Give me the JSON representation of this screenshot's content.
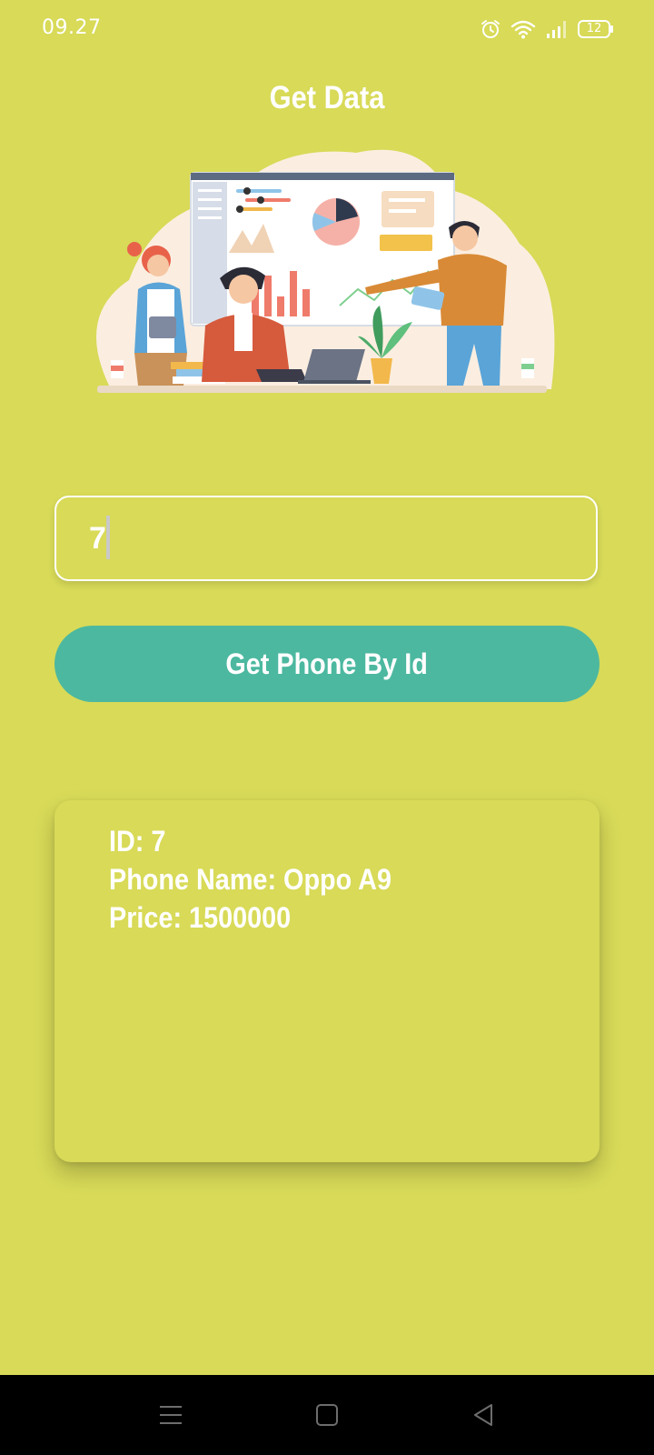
{
  "status_bar": {
    "time": "09.27",
    "battery_level": "12"
  },
  "header": {
    "title": "Get Data"
  },
  "form": {
    "id_input_value": "7",
    "button_label": "Get Phone By Id"
  },
  "result": {
    "id_line": "ID: 7",
    "name_line": "Phone Name: Oppo A9",
    "price_line": "Price: 1500000"
  },
  "icons": {
    "status": [
      "alarm-icon",
      "wifi-icon",
      "signal-icon",
      "battery-icon"
    ],
    "nav": [
      "menu-icon",
      "home-icon",
      "back-icon"
    ]
  },
  "colors": {
    "background": "#d8da58",
    "button": "#4cb8a0",
    "text": "#ffffff"
  }
}
